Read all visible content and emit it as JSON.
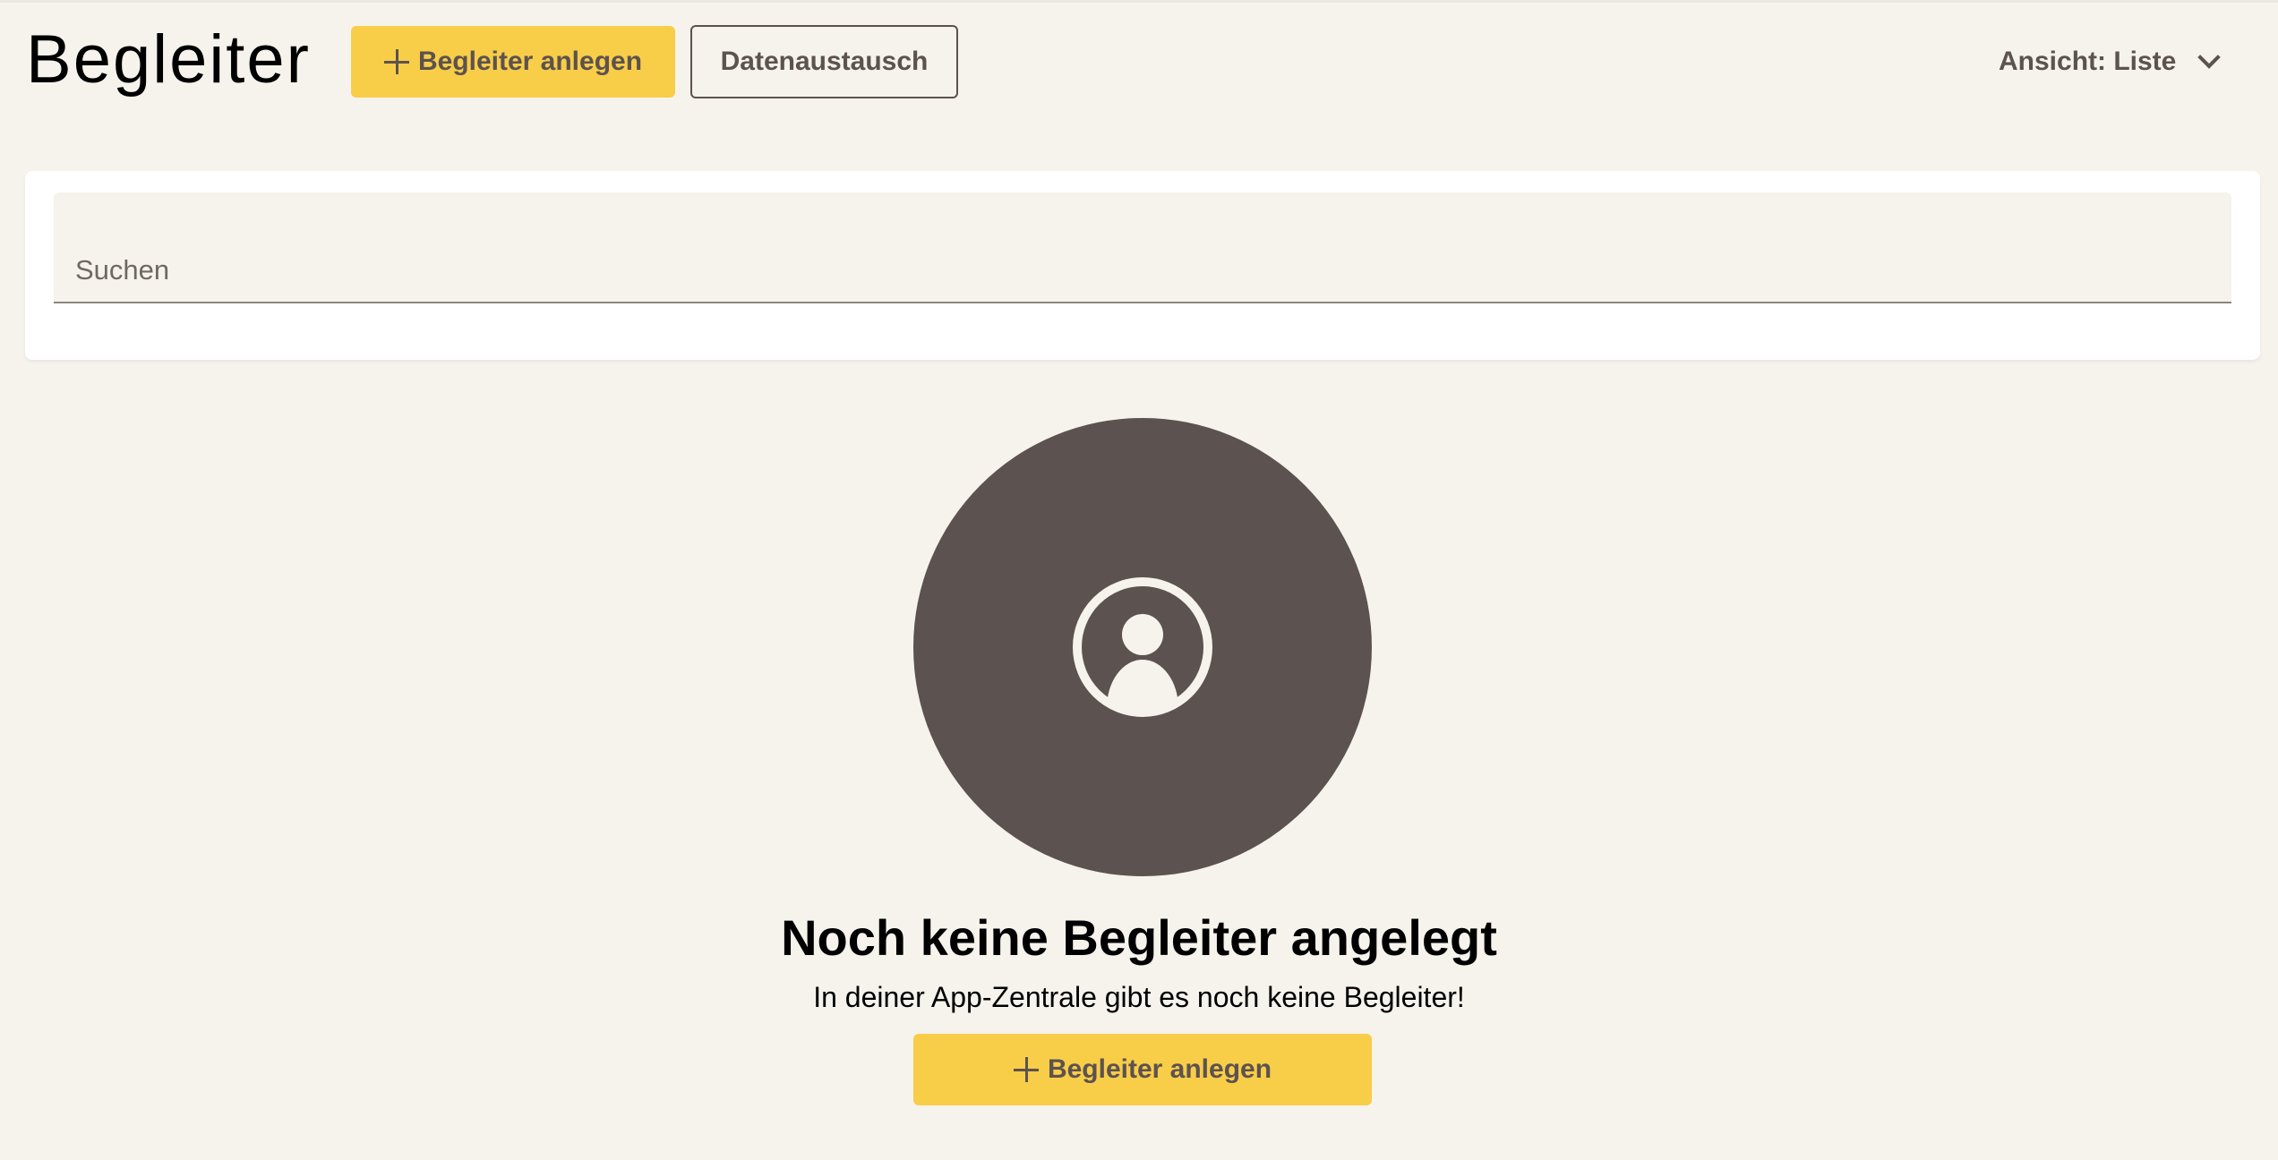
{
  "header": {
    "title": "Begleiter",
    "add_button_label": "Begleiter anlegen",
    "exchange_button_label": "Datenaustausch",
    "view_select_label": "Ansicht: Liste"
  },
  "search": {
    "placeholder": "Suchen",
    "value": ""
  },
  "empty_state": {
    "icon": "account-circle-icon",
    "title": "Noch keine Begleiter angelegt",
    "text": "In deiner App-Zentrale gibt es noch keine Begleiter!",
    "button_label": "Begleiter anlegen"
  },
  "colors": {
    "background": "#f5f3ec",
    "accent": "#f8cd48",
    "text_muted": "#5c524f",
    "icon_circle": "#5c524f",
    "card": "#ffffff"
  }
}
